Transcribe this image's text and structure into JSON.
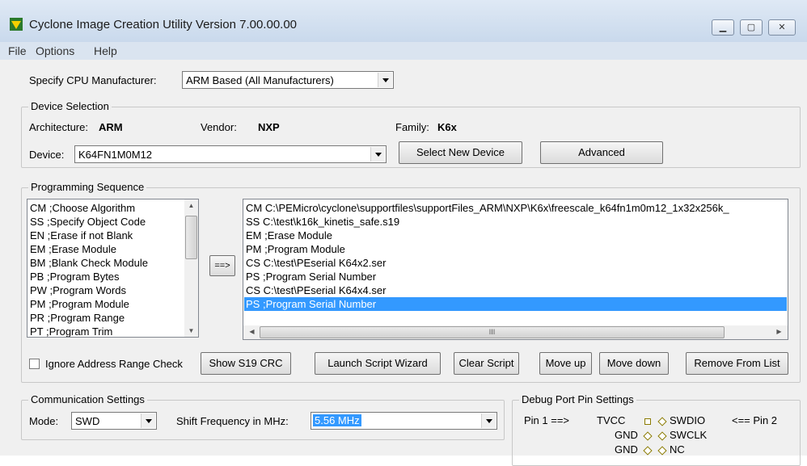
{
  "window": {
    "title": "Cyclone Image Creation Utility Version 7.00.00.00"
  },
  "menu": [
    "File",
    "Options",
    "Help"
  ],
  "cpu": {
    "label": "Specify CPU Manufacturer:",
    "value": "ARM Based (All Manufacturers)"
  },
  "device_selection": {
    "title": "Device Selection",
    "architecture_label": "Architecture:",
    "architecture": "ARM",
    "vendor_label": "Vendor:",
    "vendor": "NXP",
    "family_label": "Family:",
    "family": "K6x",
    "device_label": "Device:",
    "device": "K64FN1M0M12",
    "select_new_label": "Select New Device",
    "advanced_label": "Advanced"
  },
  "programming": {
    "title": "Programming Sequence",
    "commands": [
      "CM  ;Choose Algorithm",
      "SS  ;Specify Object Code",
      "EN  ;Erase if not Blank",
      "EM  ;Erase Module",
      "BM  ;Blank Check Module",
      "PB  ;Program Bytes",
      "PW ;Program Words",
      "PM  ;Program Module",
      "PR  ;Program Range",
      "PT  ;Program Trim"
    ],
    "add_label": "==>",
    "script": [
      "CM  C:\\PEMicro\\cyclone\\supportfiles\\supportFiles_ARM\\NXP\\K6x\\freescale_k64fn1m0m12_1x32x256k_",
      "SS  C:\\test\\k16k_kinetis_safe.s19",
      "EM  ;Erase Module",
      "PM  ;Program Module",
      "CS  C:\\test\\PEserial K64x2.ser",
      "PS  ;Program Serial Number",
      "CS  C:\\test\\PEserial K64x4.ser",
      "PS  ;Program Serial Number"
    ],
    "selected_index": 7,
    "scroll_mid": "III"
  },
  "buttons": {
    "ignore_range": "Ignore Address Range Check",
    "show_crc": "Show S19 CRC",
    "launch_wizard": "Launch Script  Wizard",
    "clear_script": "Clear Script",
    "move_up": "Move up",
    "move_down": "Move down",
    "remove": "Remove From List"
  },
  "comm": {
    "title": "Communication Settings",
    "mode_label": "Mode:",
    "mode": "SWD",
    "freq_label": "Shift Frequency in MHz:",
    "freq": "5.56 MHz"
  },
  "debug": {
    "title": "Debug Port Pin Settings",
    "pin1": "Pin 1 ==>",
    "pin2": "<== Pin 2",
    "rows": [
      {
        "left": "TVCC",
        "right": "SWDIO"
      },
      {
        "left": "GND",
        "right": "SWCLK"
      },
      {
        "left": "GND",
        "right": "NC"
      }
    ]
  }
}
